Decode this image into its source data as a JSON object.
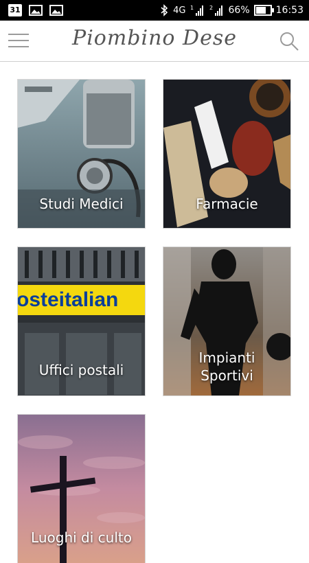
{
  "status_bar": {
    "calendar_day": "31",
    "network": "4G",
    "sim1": "1",
    "sim2": "2",
    "battery": "66%",
    "battery_level": 0.66,
    "time": "16:53"
  },
  "header": {
    "title": "Piombino Dese"
  },
  "tiles": [
    {
      "label": "Studi Medici",
      "image": "stethoscope-image"
    },
    {
      "label": "Farmacie",
      "image": "herbs-image"
    },
    {
      "label": "Uffici postali",
      "image": "post-office-image"
    },
    {
      "label": "Impianti Sportivi",
      "image": "basketball-player-image"
    },
    {
      "label": "Luoghi di culto",
      "image": "cross-image"
    }
  ],
  "colors": {
    "header_text": "#555555",
    "status_bar": "#000000"
  }
}
